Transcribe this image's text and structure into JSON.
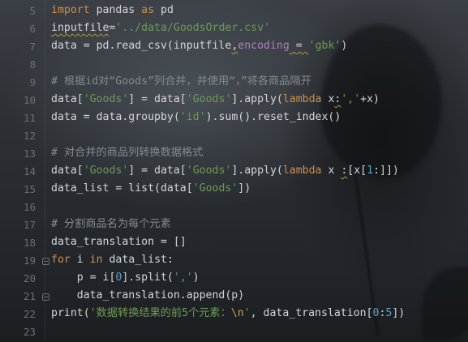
{
  "editor": {
    "line_numbers": [
      "5",
      "6",
      "7",
      "8",
      "9",
      "10",
      "11",
      "12",
      "13",
      "14",
      "15",
      "16",
      "17",
      "18",
      "19",
      "20",
      "21",
      "22",
      "23"
    ],
    "lines": [
      [
        {
          "t": "import",
          "c": "kw"
        },
        {
          "t": " pandas ",
          "c": "fn"
        },
        {
          "t": "as",
          "c": "kw"
        },
        {
          "t": " pd",
          "c": "fn"
        }
      ],
      [
        {
          "t": "inputfile",
          "c": "squig"
        },
        {
          "t": "=",
          "c": "fn"
        },
        {
          "t": "'../data/GoodsOrder.csv'",
          "c": "str"
        }
      ],
      [
        {
          "t": "data = pd.read_csv(inputfile",
          "c": "fn"
        },
        {
          "t": ",",
          "c": "squig"
        },
        {
          "t": "encoding",
          "c": "param"
        },
        {
          "t": " = ",
          "c": "squig"
        },
        {
          "t": "'gbk'",
          "c": "str"
        },
        {
          "t": ")",
          "c": "fn"
        }
      ],
      [],
      [
        {
          "t": "# 根据id对“Goods”列合并，并使用“，”将各商品隔开",
          "c": "cm"
        }
      ],
      [
        {
          "t": "data[",
          "c": "fn"
        },
        {
          "t": "'Goods'",
          "c": "str"
        },
        {
          "t": "] = data[",
          "c": "fn"
        },
        {
          "t": "'Goods'",
          "c": "str"
        },
        {
          "t": "].apply(",
          "c": "fn"
        },
        {
          "t": "lambda",
          "c": "kw"
        },
        {
          "t": " x",
          "c": "fn"
        },
        {
          "t": ":",
          "c": "squig"
        },
        {
          "t": "','",
          "c": "str"
        },
        {
          "t": "+x)",
          "c": "fn"
        }
      ],
      [
        {
          "t": "data = data.groupby(",
          "c": "fn"
        },
        {
          "t": "'id'",
          "c": "str"
        },
        {
          "t": ").sum().reset_index()",
          "c": "fn"
        }
      ],
      [],
      [
        {
          "t": "# 对合并的商品列转换数据格式",
          "c": "cm"
        }
      ],
      [
        {
          "t": "data[",
          "c": "fn"
        },
        {
          "t": "'Goods'",
          "c": "str"
        },
        {
          "t": "] = data[",
          "c": "fn"
        },
        {
          "t": "'Goods'",
          "c": "str"
        },
        {
          "t": "].apply(",
          "c": "fn"
        },
        {
          "t": "lambda",
          "c": "kw"
        },
        {
          "t": " x ",
          "c": "fn"
        },
        {
          "t": ":",
          "c": "squig"
        },
        {
          "t": "[x[",
          "c": "fn"
        },
        {
          "t": "1",
          "c": "num"
        },
        {
          "t": ":]])",
          "c": "fn"
        }
      ],
      [
        {
          "t": "data_list = ",
          "c": "fn"
        },
        {
          "t": "list",
          "c": "fn"
        },
        {
          "t": "(data[",
          "c": "fn"
        },
        {
          "t": "'Goods'",
          "c": "str"
        },
        {
          "t": "])",
          "c": "fn"
        }
      ],
      [],
      [
        {
          "t": "# 分割商品名为每个元素",
          "c": "cm"
        }
      ],
      [
        {
          "t": "data_translation = []",
          "c": "fn"
        }
      ],
      [
        {
          "t": "for",
          "c": "kw"
        },
        {
          "t": " i ",
          "c": "fn"
        },
        {
          "t": "in",
          "c": "kw"
        },
        {
          "t": " data_list:",
          "c": "fn"
        }
      ],
      [
        {
          "t": "    p = i[",
          "c": "fn"
        },
        {
          "t": "0",
          "c": "num"
        },
        {
          "t": "].split(",
          "c": "fn"
        },
        {
          "t": "','",
          "c": "str"
        },
        {
          "t": ")",
          "c": "fn"
        }
      ],
      [
        {
          "t": "    data_translation.append(p)",
          "c": "fn"
        }
      ],
      [
        {
          "t": "print",
          "c": "fn"
        },
        {
          "t": "(",
          "c": "fn"
        },
        {
          "t": "'数据转换结果的前5个元素：",
          "c": "str"
        },
        {
          "t": "\\n",
          "c": "esc"
        },
        {
          "t": "'",
          "c": "str"
        },
        {
          "t": ", data_translation[",
          "c": "fn"
        },
        {
          "t": "0",
          "c": "num"
        },
        {
          "t": ":",
          "c": "fn"
        },
        {
          "t": "5",
          "c": "num"
        },
        {
          "t": "])",
          "c": "fn"
        }
      ],
      []
    ],
    "fold_markers": [
      "19",
      "21"
    ]
  }
}
